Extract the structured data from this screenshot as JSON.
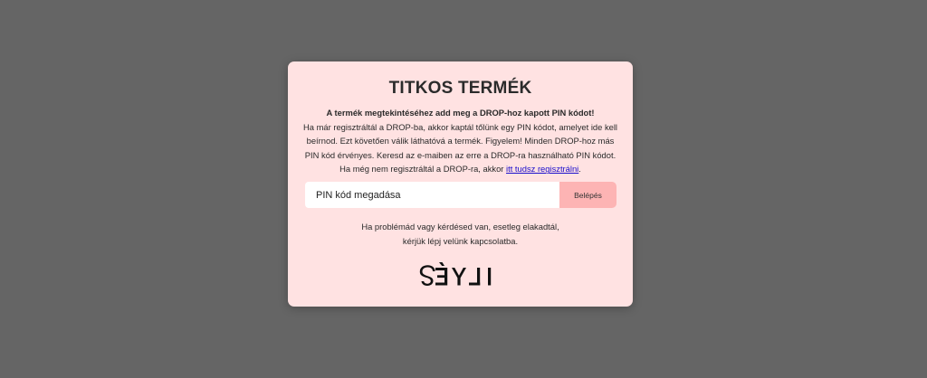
{
  "modal": {
    "title": "TITKOS TERMÉK",
    "lead": "A termék megtekintéséhez add meg a DROP-hoz kapott PIN kódot!",
    "body": "Ha már regisztráltál a DROP-ba, akkor kaptál tőlünk egy PIN kódot, amelyet ide kell beírnod. Ezt követően válik láthatóvá a termék. Figyelem! Minden DROP-hoz más PIN kód érvényes. Keresd az e-maiben az erre a DROP-ra használható PIN kódot. Ha még nem regisztráltál a DROP-ra, akkor ",
    "register_link": "itt tudsz regisztrálni",
    "body_end": ".",
    "pin_placeholder": "PIN kód megadása",
    "submit_label": "Belépés",
    "help_line1": "Ha problémád vagy kérdésed van, esetleg elakadtál,",
    "help_line2": "kérjük lépj velünk kapcsolatba.",
    "logo_text": "ILLYÉS"
  },
  "colors": {
    "overlay": "#656565",
    "modal_background": "#ffe2e2",
    "button_background": "#fdb4b4",
    "link": "#1a0dcc"
  }
}
